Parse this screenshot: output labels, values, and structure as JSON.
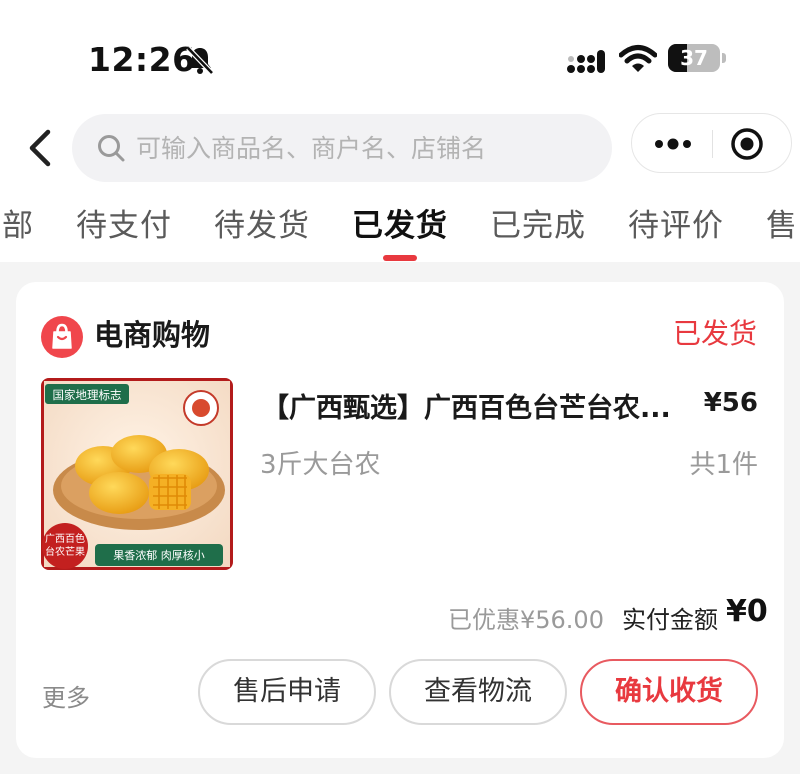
{
  "status_bar": {
    "time": "12:26",
    "battery": "37",
    "battery_level": 0.37
  },
  "header": {
    "search_placeholder": "可输入商品名、商户名、店铺名"
  },
  "tabs": [
    {
      "label": "部"
    },
    {
      "label": "待支付"
    },
    {
      "label": "待发货"
    },
    {
      "label": "已发货",
      "active": true
    },
    {
      "label": "已完成"
    },
    {
      "label": "待评价"
    },
    {
      "label": "售"
    }
  ],
  "order": {
    "shop_name": "电商购物",
    "status": "已发货",
    "product": {
      "title": "【广西甄选】广西百色台芒台农...",
      "price": "¥56",
      "spec": "3斤大台农",
      "quantity": "共1件",
      "image_badge_top": "国家地理标志",
      "image_badge_left_line1": "广西百色",
      "image_badge_left_line2": "台农芒果",
      "image_banner": "果香浓郁 肉厚核小"
    },
    "discount": "已优惠¥56.00",
    "paid_label": "实付金额",
    "paid_value": "¥0",
    "more_label": "更多",
    "buttons": {
      "after_sale": "售后申请",
      "logistics": "查看物流",
      "confirm": "确认收货"
    }
  },
  "colors": {
    "accent": "#e8393f",
    "card_bg": "#ffffff",
    "page_bg": "#f4f4f4"
  },
  "icons": [
    "bell-mute-icon",
    "cellular-signal-icon",
    "wifi-icon",
    "battery-icon",
    "back-arrow-icon",
    "search-icon",
    "more-dots-icon",
    "target-icon",
    "shopping-bag-icon"
  ]
}
